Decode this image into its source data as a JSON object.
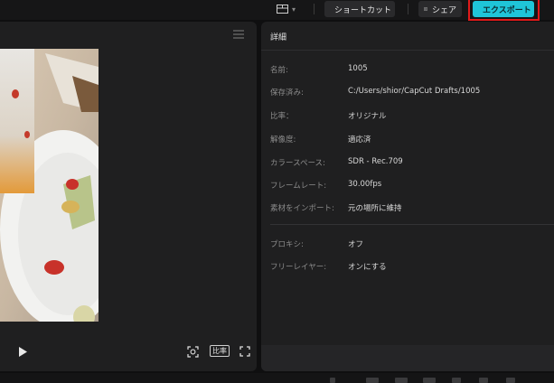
{
  "topbar": {
    "layout_icon": "layout-icon",
    "shortcut": {
      "icon": "keyboard-icon",
      "label": "ショートカット"
    },
    "share": {
      "icon": "share-icon",
      "label": "シェア"
    },
    "export": {
      "icon": "export-icon",
      "label": "エクスポート",
      "color": "#1fc5d8",
      "highlight_color": "#e01a1a"
    }
  },
  "preview": {
    "menu_icon": "hamburger-menu-icon",
    "controls": {
      "play_icon": "play-icon",
      "fit_icon": "fit-to-screen-icon",
      "ratio_label": "比率",
      "fullscreen_icon": "fullscreen-icon"
    }
  },
  "details": {
    "title": "詳細",
    "rows": [
      {
        "key": "名前:",
        "value": "1005"
      },
      {
        "key": "保存済み:",
        "value": "C:/Users/shior/CapCut Drafts/1005"
      },
      {
        "key": "比率：",
        "value": "オリジナル"
      },
      {
        "key": "解像度:",
        "value": "適応済"
      },
      {
        "key": "カラースペース:",
        "value": "SDR - Rec.709"
      },
      {
        "key": "フレームレート:",
        "value": "30.00fps"
      },
      {
        "key": "素材をインポート:",
        "value": "元の場所に維持"
      }
    ],
    "rows2": [
      {
        "key": "プロキシ:",
        "value": "オフ"
      },
      {
        "key": "フリーレイヤー:",
        "value": "オンにする"
      }
    ]
  }
}
